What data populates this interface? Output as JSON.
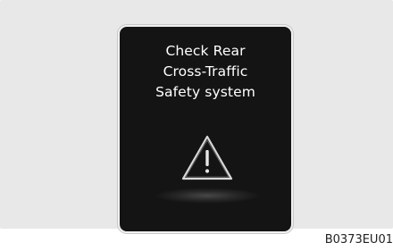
{
  "display": {
    "message_lines": [
      "Check Rear",
      "Cross-Traffic",
      "Safety system"
    ],
    "icon": "warning-triangle-icon"
  },
  "figure_code": "B0373EU01",
  "colors": {
    "background": "#e8e8e8",
    "panel": "#141414",
    "text": "#ffffff",
    "border": "#f0f0f0"
  }
}
